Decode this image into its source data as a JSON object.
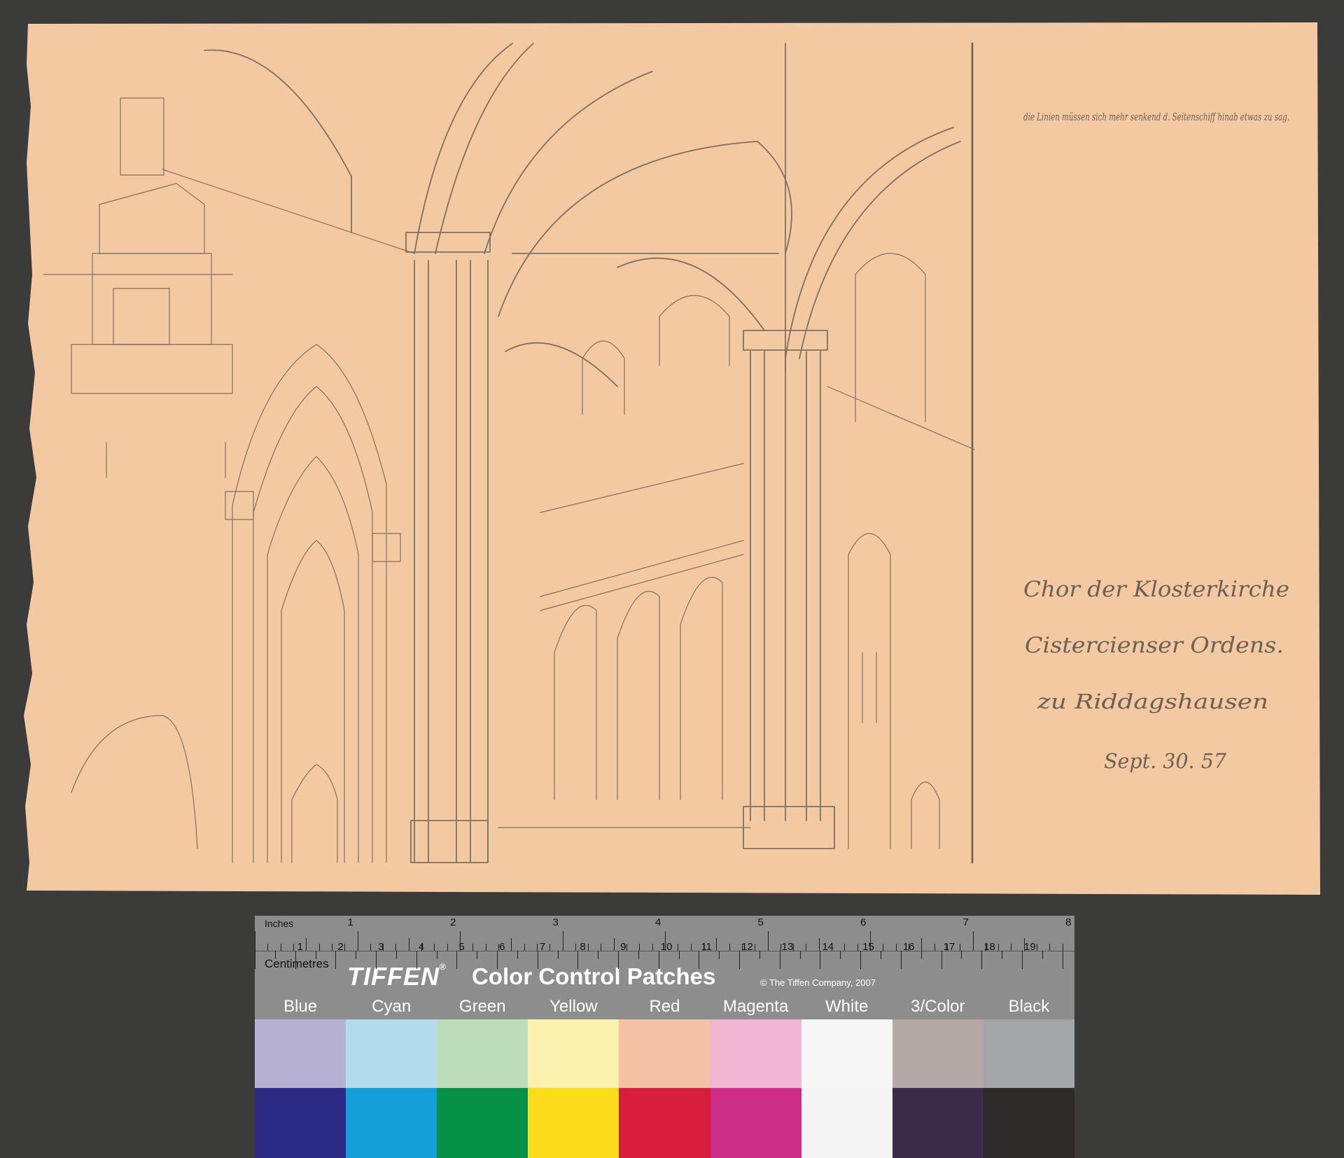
{
  "sketch": {
    "paper_color": "#f2c9a0",
    "annotation_top": "die Linien müssen sich mehr senkend d. Seitenschiff hinab etwas zu sag.",
    "title_line1": "Chor der Klosterkirche",
    "title_line2": "Cistercienser Ordens.",
    "title_line3": "zu Riddagshausen",
    "date": "Sept. 30. 57"
  },
  "card": {
    "inches_label": "Inches",
    "centimetres_label": "Centimetres",
    "brand": "TIFFEN",
    "brand_mark": "®",
    "product": "Color Control Patches",
    "copyright": "© The Tiffen Company, 2007",
    "inch_numbers": [
      "1",
      "2",
      "3",
      "4",
      "5",
      "6",
      "7",
      "8"
    ],
    "cm_numbers": [
      "1",
      "2",
      "3",
      "4",
      "5",
      "6",
      "7",
      "8",
      "9",
      "10",
      "11",
      "12",
      "13",
      "14",
      "15",
      "16",
      "17",
      "18",
      "19"
    ],
    "patches": [
      {
        "label": "Blue",
        "light": "#b6b1d3",
        "dark": "#2b2a85"
      },
      {
        "label": "Cyan",
        "light": "#b0dcec",
        "dark": "#159fd8"
      },
      {
        "label": "Green",
        "light": "#bcdcba",
        "dark": "#079048"
      },
      {
        "label": "Yellow",
        "light": "#fbf1ae",
        "dark": "#fbdc1c"
      },
      {
        "label": "Red",
        "light": "#f4c1a4",
        "dark": "#d91d3c"
      },
      {
        "label": "Magenta",
        "light": "#f1b7d2",
        "dark": "#cc2d87"
      },
      {
        "label": "White",
        "light": "#f6f6f6",
        "dark": "#f4f4f4"
      },
      {
        "label": "3/Color",
        "light": "#b5a9a8",
        "dark": "#3b2a48"
      },
      {
        "label": "Black",
        "light": "#a3a5a6",
        "dark": "#2d2b29"
      }
    ]
  }
}
